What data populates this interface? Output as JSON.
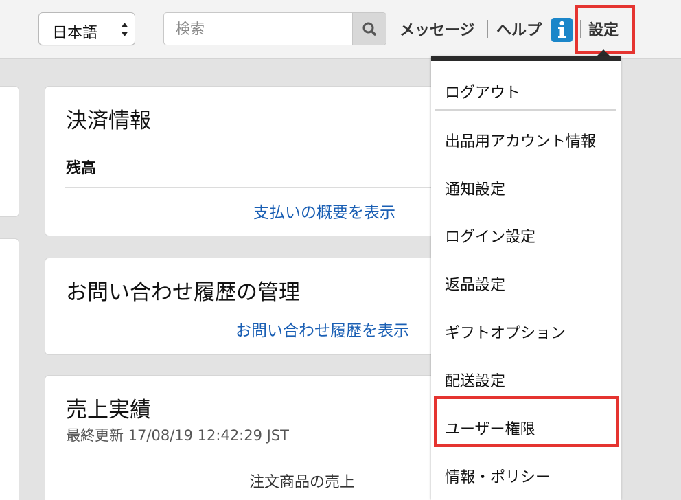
{
  "header": {
    "language": "日本語",
    "search_placeholder": "検索",
    "messages": "メッセージ",
    "help": "ヘルプ",
    "settings": "設定"
  },
  "cards": {
    "payment": {
      "title": "決済情報",
      "balance_label": "残高",
      "link": "支払いの概要を表示"
    },
    "inquiry": {
      "title": "お問い合わせ履歴の管理",
      "link": "お問い合わせ履歴を表示"
    },
    "sales": {
      "title": "売上実績",
      "updated": "最終更新 17/08/19 12:42:29 JST",
      "ordered_sales": "注文商品の売上"
    }
  },
  "settings_menu": {
    "items": [
      "ログアウト",
      "出品用アカウント情報",
      "通知設定",
      "ログイン設定",
      "返品設定",
      "ギフトオプション",
      "配送設定",
      "ユーザー権限",
      "情報・ポリシー"
    ]
  },
  "colors": {
    "highlight": "#e53430",
    "link": "#1a5fb4",
    "info_icon": "#1b86c9"
  }
}
